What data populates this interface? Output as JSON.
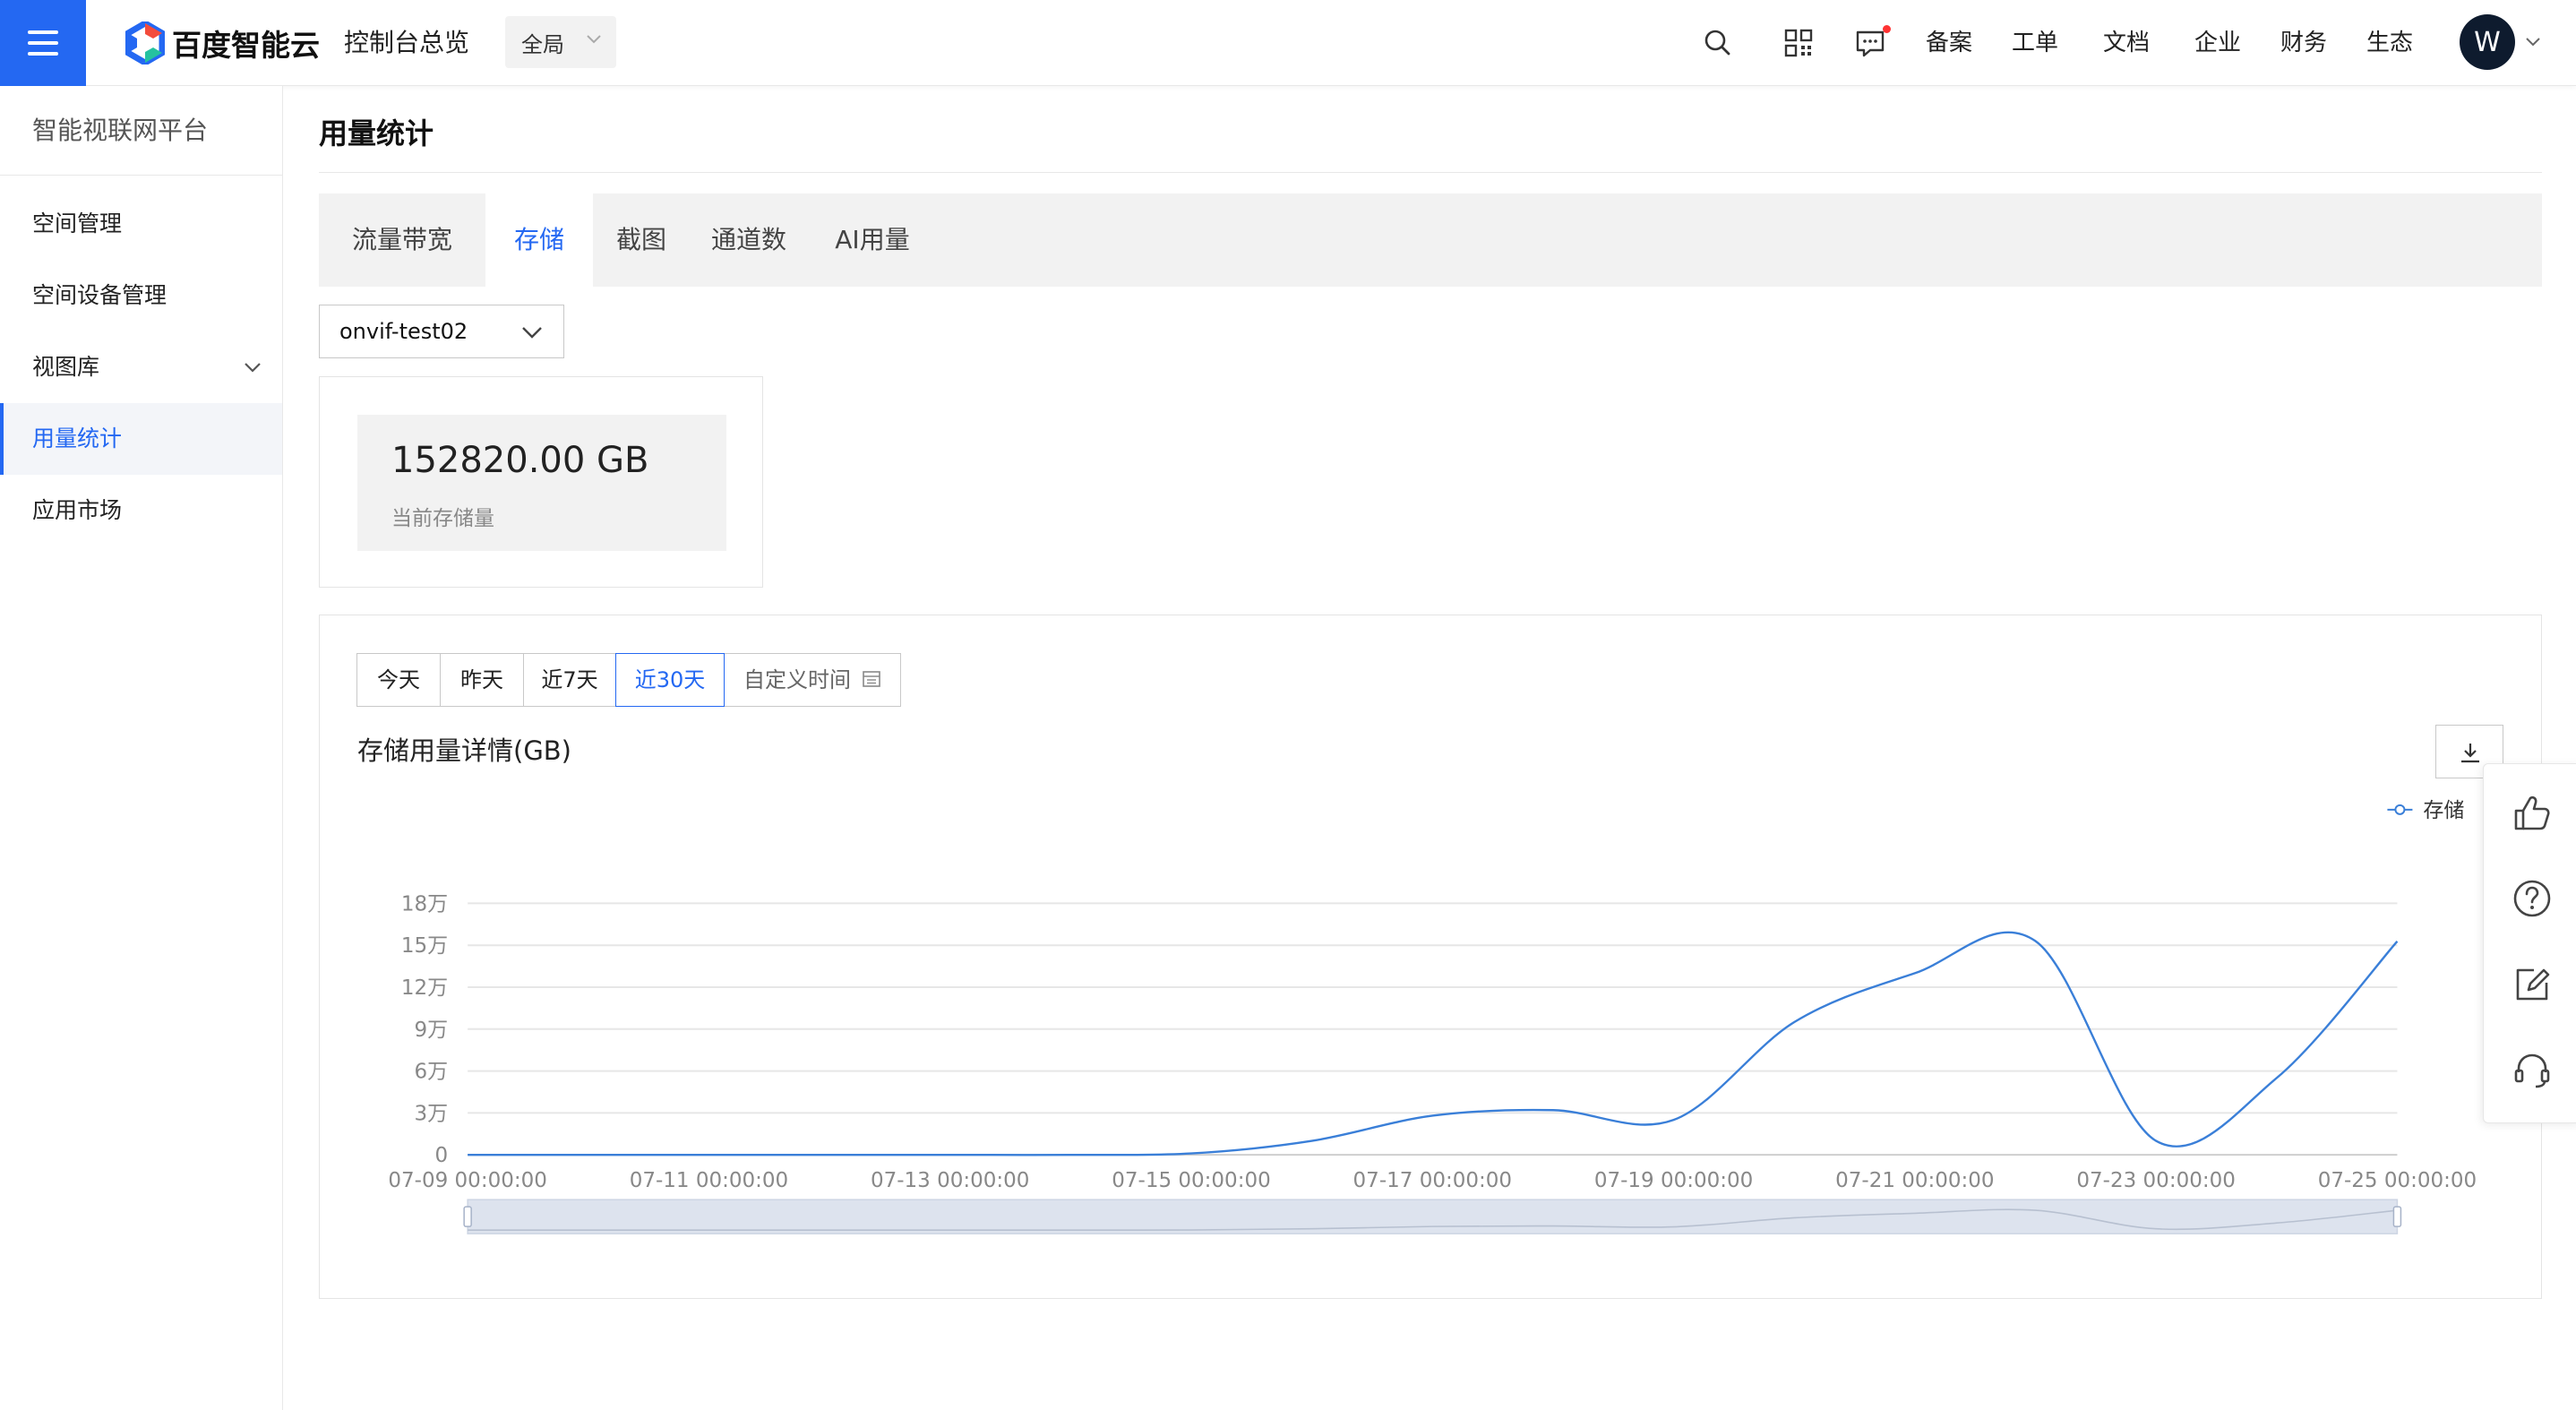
{
  "topbar": {
    "brand": "百度智能云",
    "console_title": "控制台总览",
    "region": "全局",
    "links": [
      "备案",
      "工单",
      "文档",
      "企业",
      "财务",
      "生态"
    ],
    "avatar_letter": "W"
  },
  "sidebar": {
    "title": "智能视联网平台",
    "items": [
      {
        "label": "空间管理"
      },
      {
        "label": "空间设备管理"
      },
      {
        "label": "视图库"
      },
      {
        "label": "用量统计"
      },
      {
        "label": "应用市场"
      }
    ]
  },
  "main": {
    "page_title": "用量统计",
    "tabs": [
      "流量带宽",
      "存储",
      "截图",
      "通道数",
      "AI用量"
    ],
    "active_tab": "存储",
    "instance_select": "onvif-test02",
    "stat": {
      "value": "152820.00 GB",
      "label": "当前存储量"
    },
    "range_buttons": [
      "今天",
      "昨天",
      "近7天",
      "近30天",
      "自定义时间"
    ],
    "active_range": "近30天"
  },
  "chart_data": {
    "type": "line",
    "title": "存储用量详情(GB)",
    "legend": [
      "存储"
    ],
    "legend_position": "top-right",
    "grid": true,
    "y_tick_labels": [
      "0",
      "3万",
      "6万",
      "9万",
      "12万",
      "15万",
      "18万"
    ],
    "ylim": [
      0,
      180000
    ],
    "x_tick_labels": [
      "07-09 00:00:00",
      "07-11 00:00:00",
      "07-13 00:00:00",
      "07-15 00:00:00",
      "07-17 00:00:00",
      "07-19 00:00:00",
      "07-21 00:00:00",
      "07-23 00:00:00",
      "07-25 00:00:00"
    ],
    "series": [
      {
        "name": "存储",
        "color": "#3a7fd8",
        "x": [
          "07-09",
          "07-10",
          "07-11",
          "07-12",
          "07-13",
          "07-14",
          "07-15",
          "07-16",
          "07-17",
          "07-18",
          "07-19",
          "07-20",
          "07-21",
          "07-22",
          "07-23",
          "07-24",
          "07-25"
        ],
        "values": [
          0,
          0,
          0,
          0,
          0,
          0,
          1000,
          10000,
          28000,
          32000,
          25000,
          95000,
          130000,
          153000,
          10000,
          55000,
          152820
        ]
      }
    ]
  }
}
